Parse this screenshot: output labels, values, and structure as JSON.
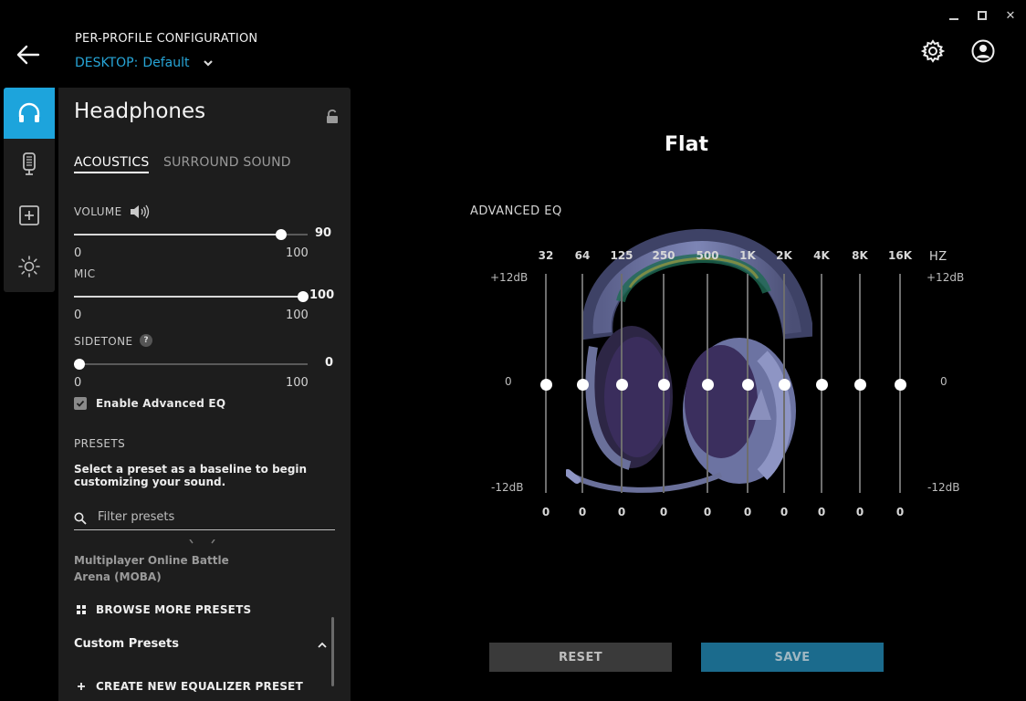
{
  "window": {
    "minimize": "",
    "maximize": "",
    "close": "✕"
  },
  "header": {
    "title": "PER-PROFILE CONFIGURATION",
    "profile_prefix": "DESKTOP:",
    "profile_name": "Default"
  },
  "rail": {
    "items": [
      {
        "icon": "headphones-icon",
        "active": true
      },
      {
        "icon": "microphone-icon",
        "active": false
      },
      {
        "icon": "add-square-icon",
        "active": false
      },
      {
        "icon": "lighting-icon",
        "active": false
      }
    ]
  },
  "panel": {
    "title": "Headphones",
    "tabs": [
      "ACOUSTICS",
      "SURROUND SOUND"
    ],
    "volume": {
      "label": "VOLUME",
      "value": 90,
      "min": "0",
      "max": "100",
      "value_text": "90"
    },
    "mic": {
      "label": "MIC",
      "value": 100,
      "min": "0",
      "max": "100",
      "value_text": "100"
    },
    "sidetone": {
      "label": "SIDETONE",
      "help": "?",
      "value": 0,
      "min": "0",
      "max": "100",
      "value_text": "0"
    },
    "advanced_eq_label": "Enable Advanced EQ",
    "advanced_eq_checked": true,
    "presets": {
      "header": "PRESETS",
      "description": "Select a preset as a baseline to begin customizing your sound.",
      "filter_placeholder": "Filter presets",
      "item": "Multiplayer Online Battle Arena (MOBA)",
      "browse_label": "BROWSE MORE PRESETS",
      "custom_label": "Custom Presets",
      "create_label": "CREATE NEW EQUALIZER PRESET"
    }
  },
  "eq": {
    "preset_name": "Flat",
    "title": "ADVANCED EQ",
    "hz_label": "HZ",
    "top_db": "+12dB",
    "mid_db": "0",
    "bottom_db": "-12dB",
    "bands": [
      {
        "freq": "32",
        "value": "0"
      },
      {
        "freq": "64",
        "value": "0"
      },
      {
        "freq": "125",
        "value": "0"
      },
      {
        "freq": "250",
        "value": "0"
      },
      {
        "freq": "500",
        "value": "0"
      },
      {
        "freq": "1K",
        "value": "0"
      },
      {
        "freq": "2K",
        "value": "0"
      },
      {
        "freq": "4K",
        "value": "0"
      },
      {
        "freq": "8K",
        "value": "0"
      },
      {
        "freq": "16K",
        "value": "0"
      }
    ]
  },
  "buttons": {
    "reset": "RESET",
    "save": "SAVE"
  },
  "colors": {
    "accent": "#1da4dc",
    "profile_text": "#27a5d7",
    "save_bg": "#1b6b8d"
  }
}
